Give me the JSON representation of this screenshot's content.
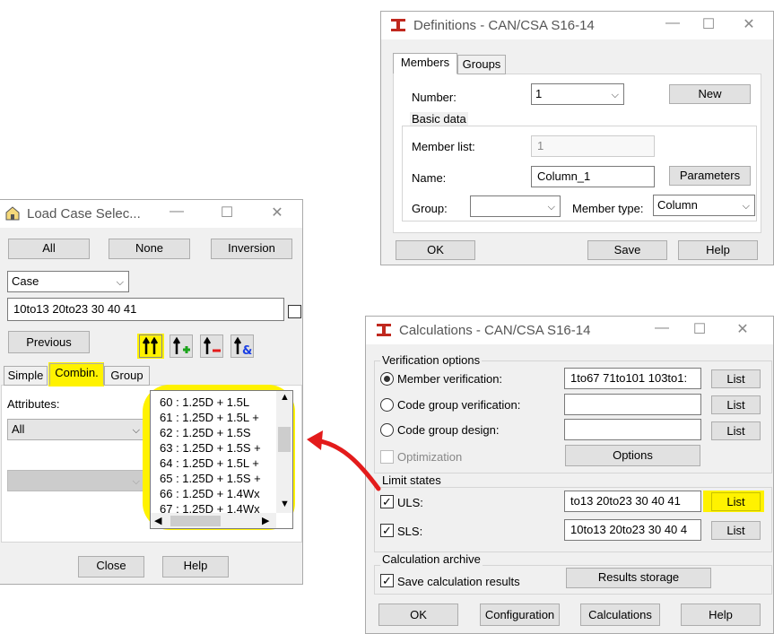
{
  "definitions": {
    "title": "Definitions - CAN/CSA S16-14",
    "tabs": [
      "Members",
      "Groups"
    ],
    "number_label": "Number:",
    "number_value": "1",
    "new_button": "New",
    "basic_data": "Basic data",
    "member_list_label": "Member list:",
    "member_list_value": "1",
    "name_label": "Name:",
    "name_value": "Column_1",
    "parameters_button": "Parameters",
    "group_label": "Group:",
    "group_value": "",
    "member_type_label": "Member type:",
    "member_type_value": "Column",
    "ok_button": "OK",
    "save_button": "Save",
    "help_button": "Help"
  },
  "load_case": {
    "title": "Load Case Selec...",
    "all_button": "All",
    "none_button": "None",
    "inversion_button": "Inversion",
    "case_combo": "Case",
    "selection_value": "10to13 20to23 30 40 41",
    "previous_button": "Previous",
    "tabs": [
      "Simple",
      "Combin.",
      "Group"
    ],
    "attributes_label": "Attributes:",
    "attributes_value": "All",
    "list_items": [
      "60 : 1.25D + 1.5L",
      "61 : 1.25D + 1.5L +",
      "62 : 1.25D + 1.5S",
      "63 : 1.25D + 1.5S +",
      "64 : 1.25D + 1.5L +",
      "65 : 1.25D + 1.5S +",
      "66 : 1.25D + 1.4Wx",
      "67 : 1.25D + 1.4Wx"
    ],
    "close_button": "Close",
    "help_button": "Help"
  },
  "calculations": {
    "title": "Calculations - CAN/CSA S16-14",
    "verification_options": "Verification options",
    "member_verification_label": "Member verification:",
    "member_verification_value": "1to67 71to101 103to1:",
    "code_group_verification_label": "Code group verification:",
    "code_group_verification_value": "",
    "code_group_design_label": "Code group design:",
    "code_group_design_value": "",
    "optimization_label": "Optimization",
    "options_button": "Options",
    "list_button": "List",
    "limit_states": "Limit states",
    "uls_label": "ULS:",
    "uls_value": "to13 20to23 30 40 41",
    "sls_label": "SLS:",
    "sls_value": "10to13 20to23 30 40 4",
    "calculation_archive": "Calculation archive",
    "save_results_label": "Save calculation results",
    "results_storage_button": "Results storage",
    "ok_button": "OK",
    "configuration_button": "Configuration",
    "calculations_button": "Calculations",
    "help_button": "Help"
  },
  "colors": {
    "highlight": "#fff200",
    "arrow": "#e31b1b",
    "window_bg": "#f0f0f0"
  }
}
